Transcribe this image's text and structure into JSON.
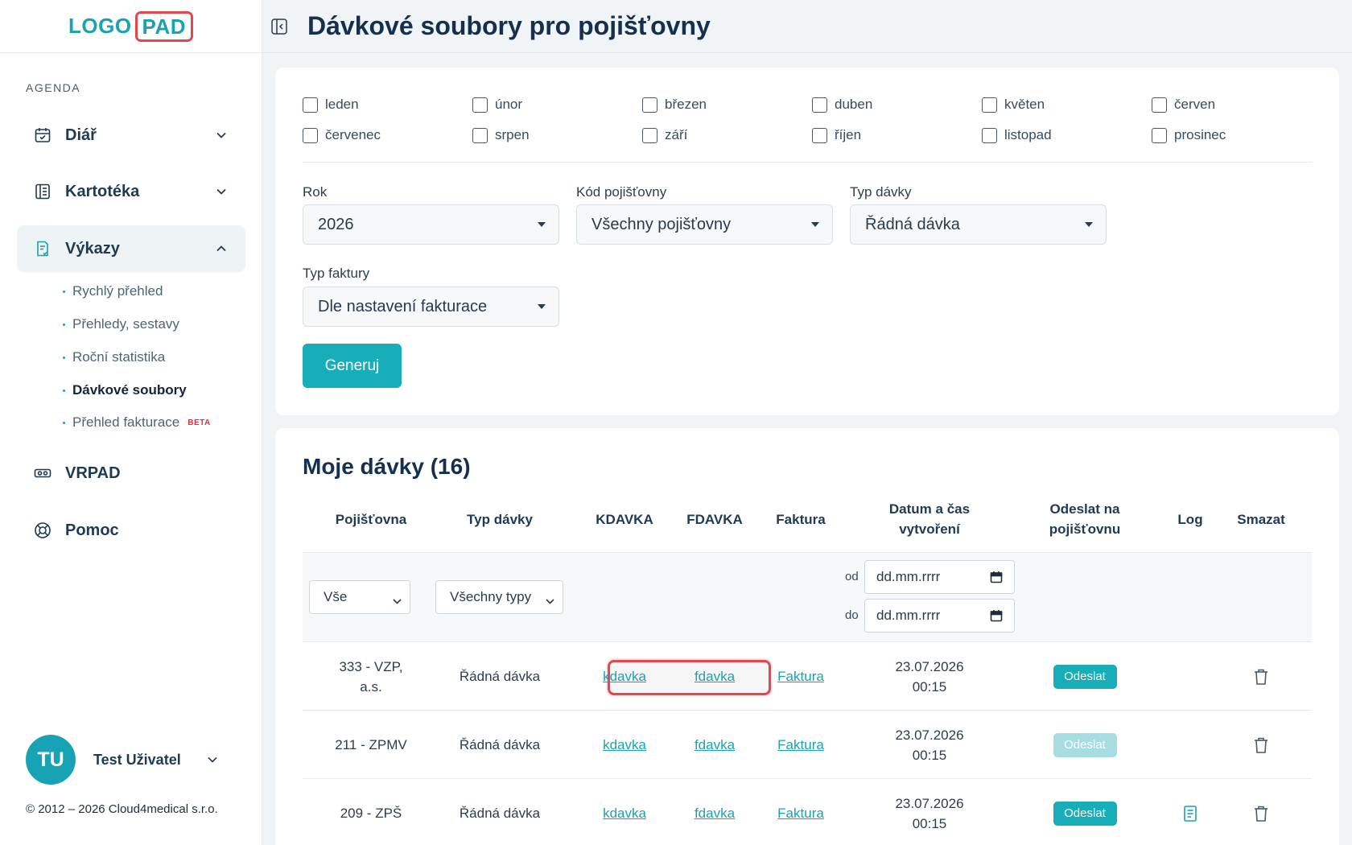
{
  "logo": {
    "part1": "LOGO",
    "part2": "PAD"
  },
  "sidebar": {
    "section_label": "AGENDA",
    "items": [
      {
        "label": "Diář",
        "icon": "calendar-icon"
      },
      {
        "label": "Kartotéka",
        "icon": "book-icon"
      },
      {
        "label": "Výkazy",
        "icon": "report-icon"
      },
      {
        "label": "VRPAD",
        "icon": "vr-headset-icon"
      },
      {
        "label": "Pomoc",
        "icon": "lifebuoy-icon"
      }
    ],
    "sub_items": [
      {
        "label": "Rychlý přehled"
      },
      {
        "label": "Přehledy, sestavy"
      },
      {
        "label": "Roční statistika"
      },
      {
        "label": "Dávkové soubory"
      },
      {
        "label": "Přehled fakturace",
        "badge": "BETA"
      }
    ],
    "user": {
      "initials": "TU",
      "name": "Test Uživatel"
    },
    "copyright": "© 2012 – 2026 Cloud4medical s.r.o."
  },
  "header": {
    "title": "Dávkové soubory pro pojišťovny"
  },
  "form": {
    "months": [
      "leden",
      "únor",
      "březen",
      "duben",
      "květen",
      "červen",
      "červenec",
      "srpen",
      "září",
      "říjen",
      "listopad",
      "prosinec"
    ],
    "year_label": "Rok",
    "year_value": "2026",
    "insurer_label": "Kód pojišťovny",
    "insurer_value": "Všechny pojišťovny",
    "batch_type_label": "Typ dávky",
    "batch_type_value": "Řádná dávka",
    "invoice_type_label": "Typ faktury",
    "invoice_type_value": "Dle nastavení fakturace",
    "generate_label": "Generuj"
  },
  "batches": {
    "title": "Moje dávky (16)",
    "columns": {
      "insurer": "Pojišťovna",
      "type": "Typ dávky",
      "kdavka": "KDAVKA",
      "fdavka": "FDAVKA",
      "invoice": "Faktura",
      "created_line1": "Datum a čas",
      "created_line2": "vytvoření",
      "send_line1": "Odeslat na",
      "send_line2": "pojišťovnu",
      "log": "Log",
      "delete": "Smazat"
    },
    "filters": {
      "insurer_value": "Vše",
      "type_value": "Všechny typy",
      "from_label": "od",
      "to_label": "do",
      "date_placeholder": "dd.mm.rrrr"
    },
    "rows": [
      {
        "insurer_line1": "333 - VZP,",
        "insurer_line2": "a.s.",
        "type": "Řádná dávka",
        "kdavka": "kdavka",
        "fdavka": "fdavka",
        "invoice": "Faktura",
        "date": "23.07.2026",
        "time": "00:15",
        "send": "Odeslat"
      },
      {
        "insurer_line1": "211 - ZPMV",
        "insurer_line2": "",
        "type": "Řádná dávka",
        "kdavka": "kdavka",
        "fdavka": "fdavka",
        "invoice": "Faktura",
        "date": "23.07.2026",
        "time": "00:15",
        "send": "Odeslat"
      },
      {
        "insurer_line1": "209 - ZPŠ",
        "insurer_line2": "",
        "type": "Řádná dávka",
        "kdavka": "kdavka",
        "fdavka": "fdavka",
        "invoice": "Faktura",
        "date": "23.07.2026",
        "time": "00:15",
        "send": "Odeslat"
      }
    ]
  },
  "colors": {
    "accent": "#17adb9",
    "highlight": "#e0484d",
    "beta": "#e0303a"
  }
}
